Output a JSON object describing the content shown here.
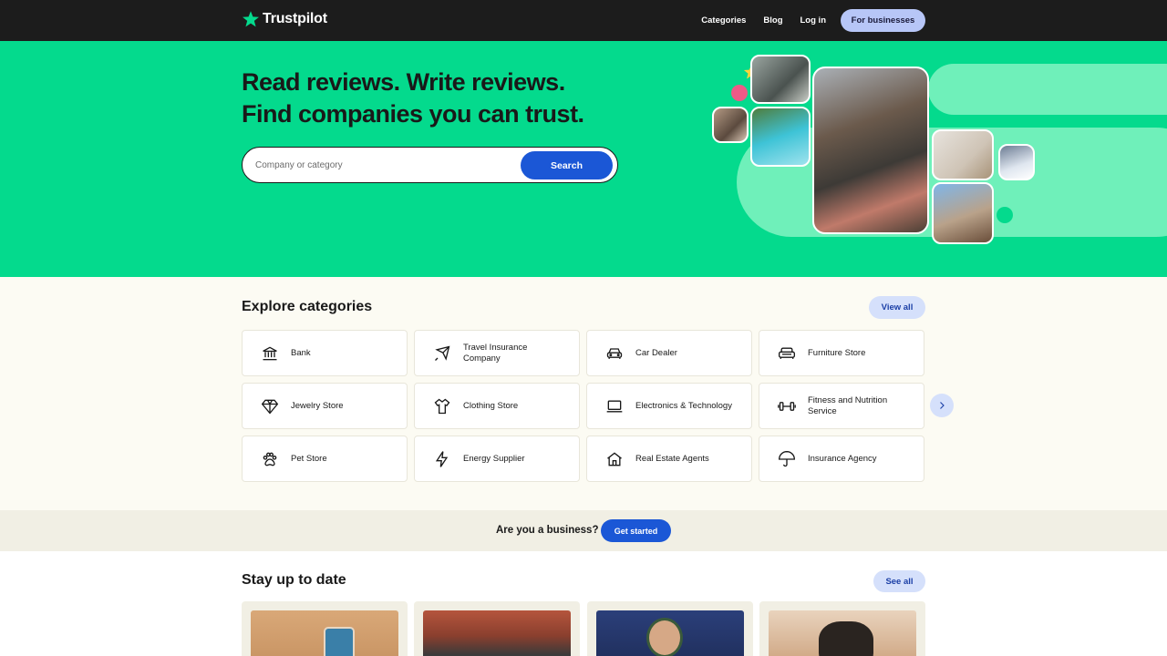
{
  "header": {
    "brand": "Trustpilot",
    "nav": {
      "categories": "Categories",
      "blog": "Blog",
      "login": "Log in",
      "for_businesses": "For businesses"
    }
  },
  "hero": {
    "title_line1": "Read reviews. Write reviews.",
    "title_line2": "Find companies you can trust.",
    "search_placeholder": "Company or category",
    "search_button": "Search"
  },
  "categories": {
    "title": "Explore categories",
    "view_all": "View all",
    "items": [
      {
        "label": "Bank",
        "icon": "bank-icon"
      },
      {
        "label": "Travel Insurance Company",
        "icon": "airplane-icon"
      },
      {
        "label": "Car Dealer",
        "icon": "car-icon"
      },
      {
        "label": "Furniture Store",
        "icon": "sofa-icon"
      },
      {
        "label": "Jewelry Store",
        "icon": "diamond-icon"
      },
      {
        "label": "Clothing Store",
        "icon": "shirt-icon"
      },
      {
        "label": "Electronics & Technology",
        "icon": "laptop-icon"
      },
      {
        "label": "Fitness and Nutrition Service",
        "icon": "dumbbell-icon"
      },
      {
        "label": "Pet Store",
        "icon": "paw-icon"
      },
      {
        "label": "Energy Supplier",
        "icon": "lightning-icon"
      },
      {
        "label": "Real Estate Agents",
        "icon": "house-icon"
      },
      {
        "label": "Insurance Agency",
        "icon": "umbrella-icon"
      }
    ]
  },
  "business_banner": {
    "question": "Are you a business?",
    "cta": "Get started"
  },
  "stay": {
    "title": "Stay up to date",
    "see_all": "See all"
  },
  "colors": {
    "brand_green": "#04da8d",
    "header_dark": "#1c1c1c",
    "primary_blue": "#1b57d6",
    "pill_blue": "#d5e0fb",
    "cream_bg": "#fcfbf3"
  }
}
